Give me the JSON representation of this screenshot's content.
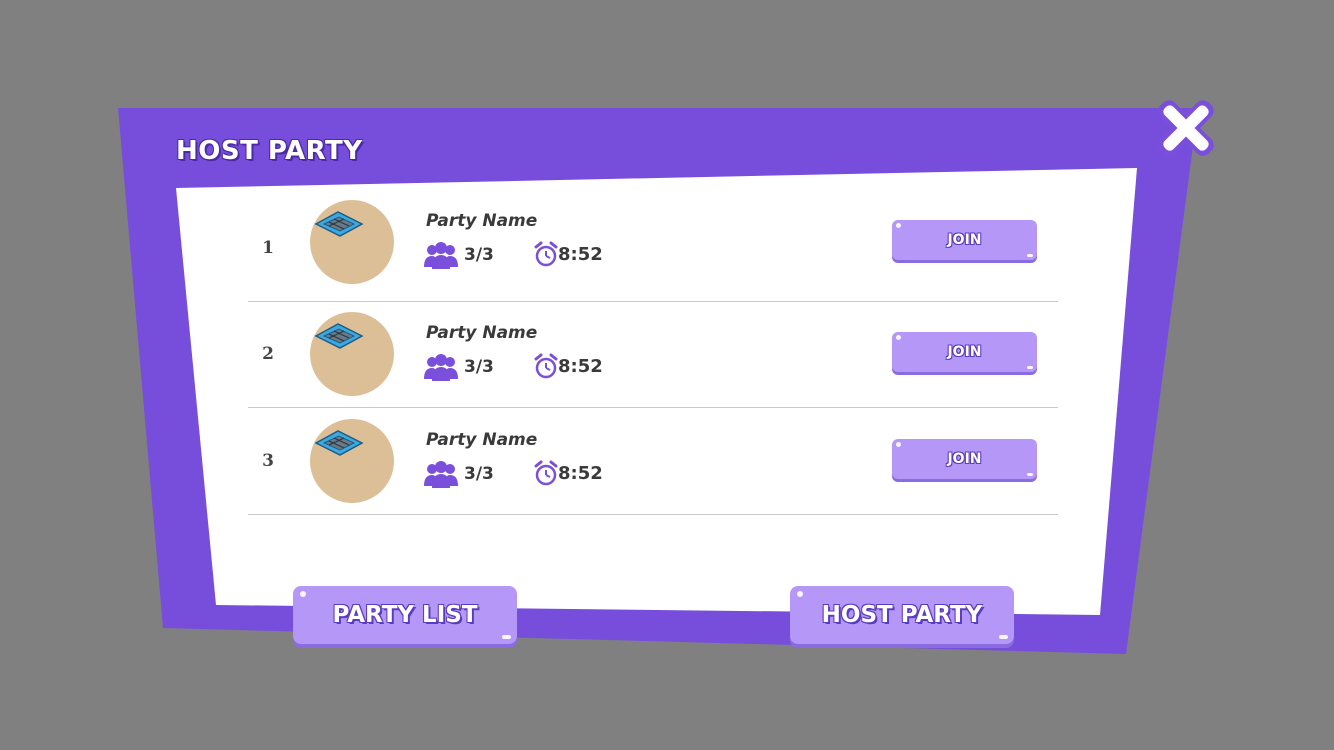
{
  "dialog": {
    "title": "HOST PARTY",
    "close_icon": "close-x-icon",
    "colors": {
      "frame": "#7a4fdc",
      "panel": "#ffffff",
      "button": "#b497f7",
      "backdrop": "#808080"
    }
  },
  "parties": [
    {
      "rank": "1",
      "name": "Party Name",
      "players": "3/3",
      "time": "8:52",
      "join_label": "JOIN"
    },
    {
      "rank": "2",
      "name": "Party Name",
      "players": "3/3",
      "time": "8:52",
      "join_label": "JOIN"
    },
    {
      "rank": "3",
      "name": "Party Name",
      "players": "3/3",
      "time": "8:52",
      "join_label": "JOIN"
    }
  ],
  "footer": {
    "party_list_label": "PARTY LIST",
    "host_party_label": "HOST PARTY"
  }
}
